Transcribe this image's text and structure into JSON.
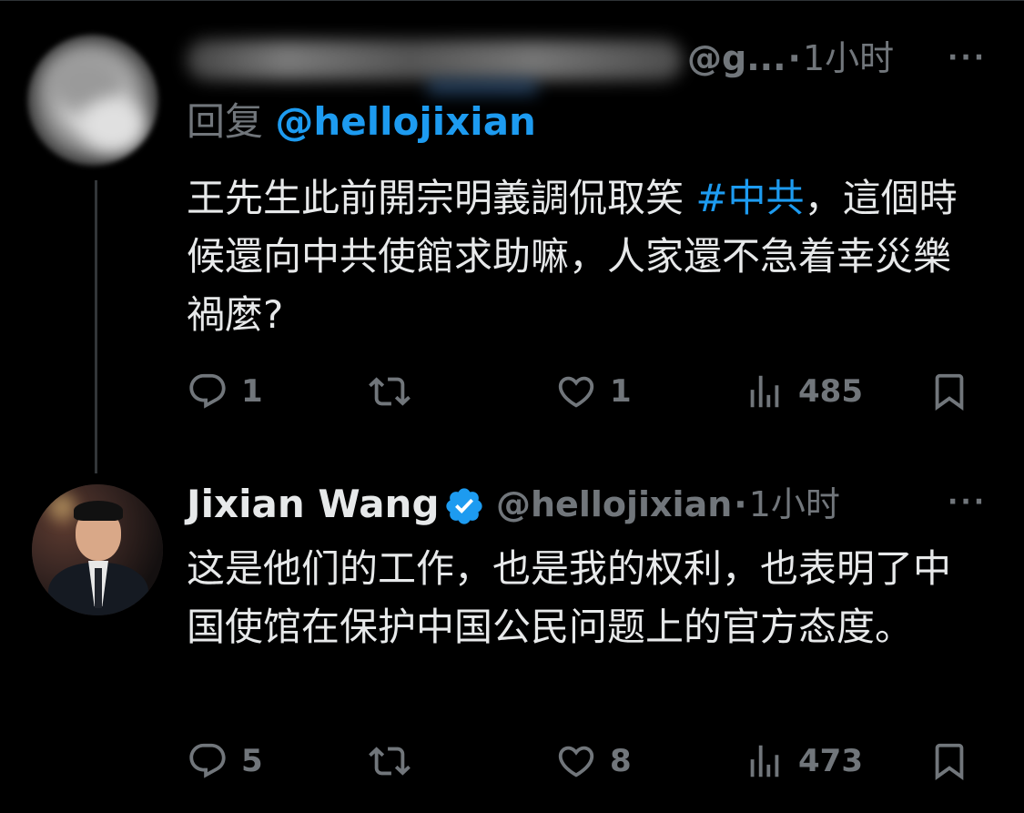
{
  "colors": {
    "background": "#000000",
    "text": "#e7e9ea",
    "muted": "#71767b",
    "accent": "#1d9bf0",
    "thread_line": "#333639"
  },
  "tweets": [
    {
      "avatar": "blurred-avatar",
      "handle_suffix": "@g...",
      "separator": "·",
      "time": "1小时",
      "more": "···",
      "reply_label": "回复",
      "reply_handle": "@hellojixian",
      "text_before": "王先生此前開宗明義調侃取笑 ",
      "hashtag": "#中共",
      "text_after": "，這個時候還向中共使館求助嘛，人家還不急着幸災樂禍麼?",
      "actions": {
        "reply_icon": "reply-icon",
        "reply_count": "1",
        "retweet_icon": "retweet-icon",
        "retweet_count": "",
        "like_icon": "heart-icon",
        "like_count": "1",
        "views_icon": "views-icon",
        "views_count": "485",
        "bookmark_icon": "bookmark-icon"
      }
    },
    {
      "avatar": "profile-photo",
      "display_name": "Jixian Wang",
      "verified_icon": "verified-badge-icon",
      "handle": "@hellojixian",
      "separator": "·",
      "time": "1小时",
      "more": "···",
      "text": "这是他们的工作，也是我的权利，也表明了中国使馆在保护中国公民问题上的官方态度。",
      "actions": {
        "reply_icon": "reply-icon",
        "reply_count": "5",
        "retweet_icon": "retweet-icon",
        "retweet_count": "",
        "like_icon": "heart-icon",
        "like_count": "8",
        "views_icon": "views-icon",
        "views_count": "473",
        "bookmark_icon": "bookmark-icon"
      }
    }
  ]
}
